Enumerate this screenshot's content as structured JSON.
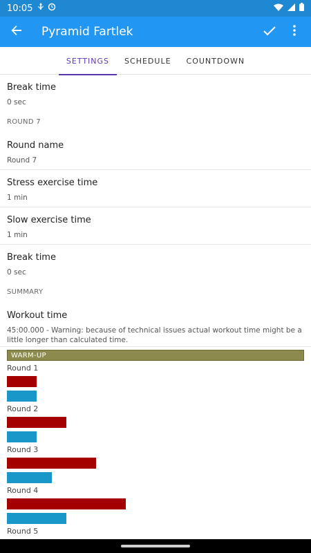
{
  "status_bar": {
    "time": "10:05",
    "icons_left": [
      "usb-icon",
      "alarm-icon"
    ],
    "icons_right": [
      "wifi-icon",
      "signal-icon",
      "battery-icon"
    ]
  },
  "app_bar": {
    "title": "Pyramid Fartlek",
    "back_icon": "arrow-back-icon",
    "confirm_icon": "check-icon",
    "overflow_icon": "more-vert-icon",
    "color": "#2196f3"
  },
  "tabs": [
    {
      "label": "SETTINGS",
      "active": true
    },
    {
      "label": "SCHEDULE",
      "active": false
    },
    {
      "label": "COUNTDOWN",
      "active": false
    }
  ],
  "list": {
    "break_time_1": {
      "label": "Break time",
      "value": "0 sec"
    },
    "round7_section": "ROUND 7",
    "round_name": {
      "label": "Round name",
      "value": "Round 7"
    },
    "stress_time": {
      "label": "Stress exercise time",
      "value": "1 min"
    },
    "slow_time": {
      "label": "Slow exercise time",
      "value": "1 min"
    },
    "break_time_2": {
      "label": "Break time",
      "value": "0 sec"
    },
    "summary_section": "SUMMARY",
    "workout_time": {
      "label": "Workout time",
      "value": "45:00.000 - Warning: because of technical issues actual workout time might be a little longer than calculated time."
    }
  },
  "chart_data": {
    "type": "bar",
    "header": "WARM-UP",
    "categories": [
      "Round 1",
      "Round 2",
      "Round 3",
      "Round 4",
      "Round 5"
    ],
    "series": [
      {
        "color": "#a40000",
        "values": [
          1,
          2,
          3,
          4
        ]
      },
      {
        "color": "#1a97c9",
        "values": [
          1,
          1,
          1.5,
          2
        ]
      }
    ]
  }
}
